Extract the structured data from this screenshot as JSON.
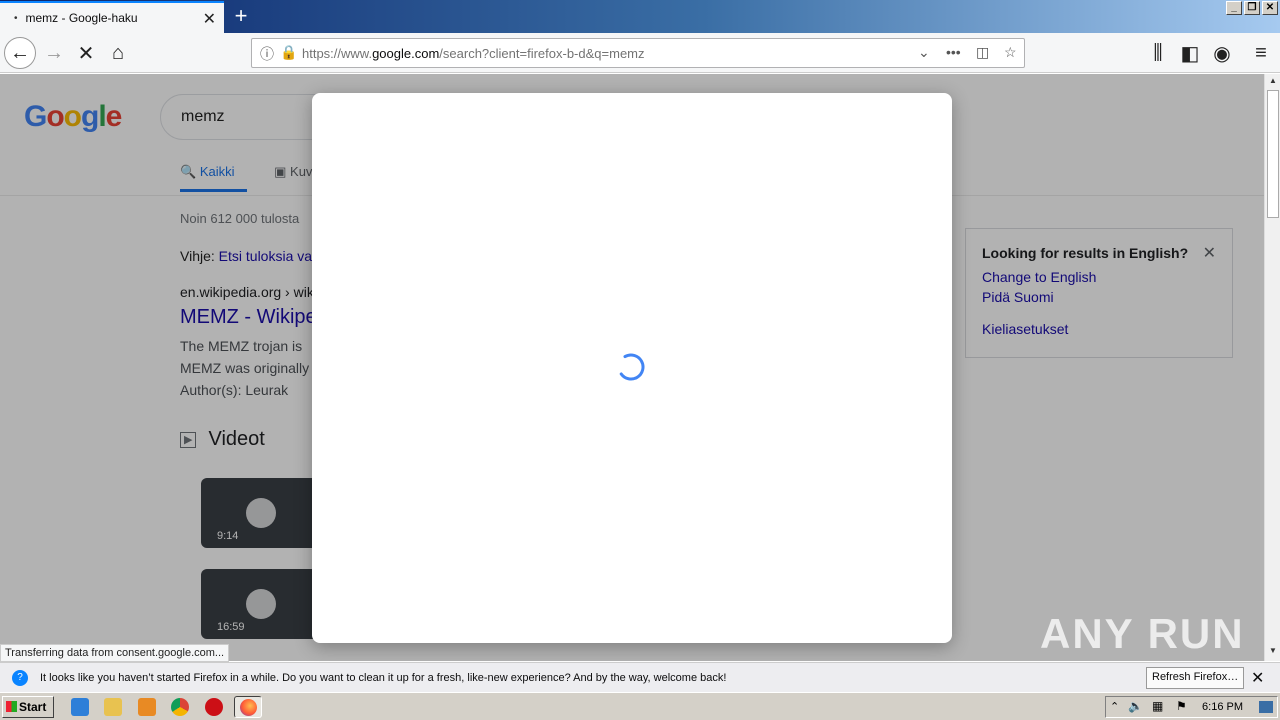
{
  "browser": {
    "tab_title": "memz - Google-haku",
    "tab_dot": "•",
    "new_tab": "+",
    "url_prefix": "https://www.",
    "url_host": "google.com",
    "url_path": "/search?client=firefox-b-d&q=memz"
  },
  "google": {
    "logo": "Google",
    "query": "memz",
    "tab_all": "Kaikki",
    "tab_images": "Kuvat",
    "result_count": "Noin 612 000 tulosta",
    "hint_prefix": "Vihje: ",
    "hint_link": "Etsi tuloksia va",
    "cite": "en.wikipedia.org › wiki",
    "result_title": "MEMZ - Wikipe",
    "snippet_1": "The MEMZ trojan is",
    "snippet_2": "MEMZ was originally",
    "snippet_3": "Author(s): Leurak",
    "videos_heading": "Videot",
    "video_1_duration": "9:14",
    "video_2_duration": "16:59"
  },
  "english_box": {
    "title": "Looking for results in English?",
    "link_change": "Change to English",
    "link_keep": "Pidä Suomi",
    "link_settings": "Kieliasetukset"
  },
  "status_text": "Transferring data from consent.google.com...",
  "notification": {
    "message": "It looks like you haven’t started Firefox in a while. Do you want to clean it up for a fresh, like-new experience? And by the way, welcome back!",
    "button": "Refresh Firefox…"
  },
  "watermark": "ANY RUN",
  "taskbar": {
    "start": "Start",
    "clock": "6:16 PM"
  },
  "colors": {
    "spinner": "#4285f4",
    "link": "#1a0dab",
    "firefox_accent": "#0a84ff"
  }
}
